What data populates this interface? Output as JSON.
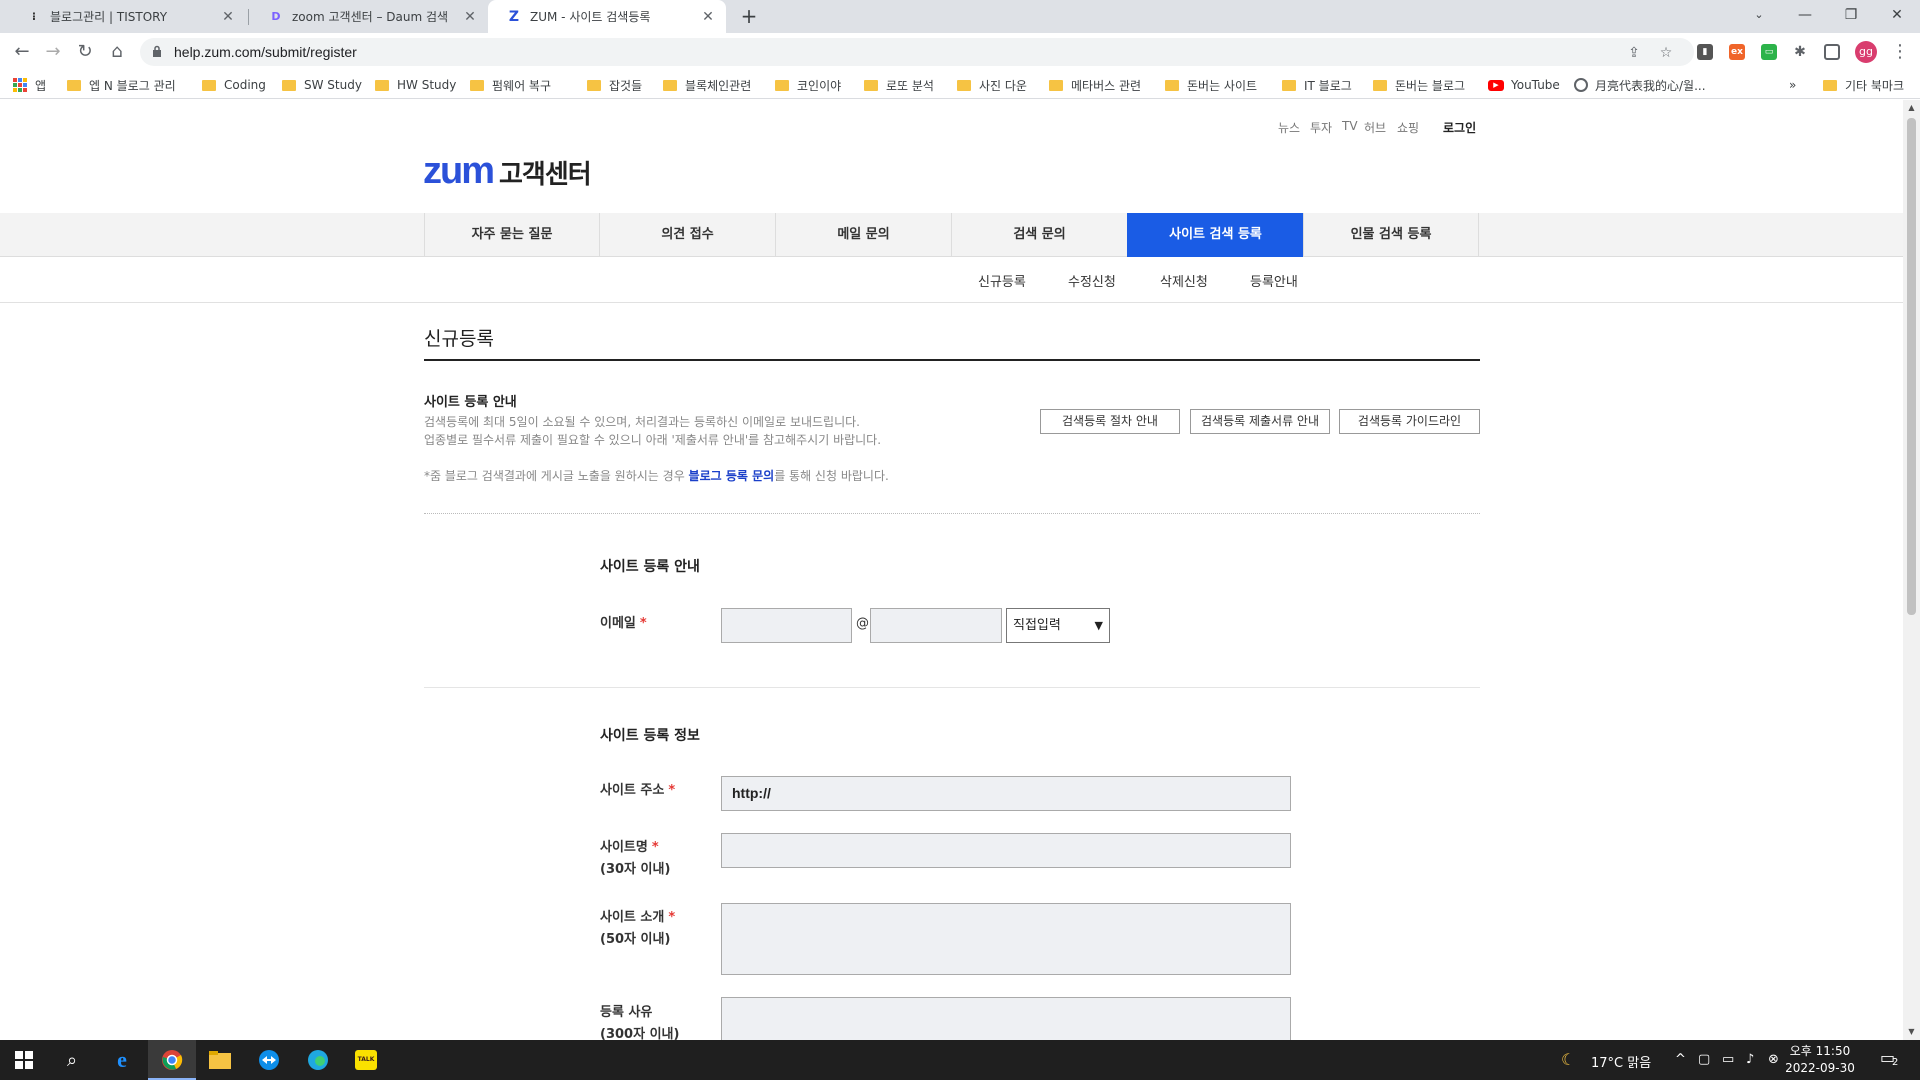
{
  "browser": {
    "tabs": [
      {
        "title": "블로그관리 | TISTORY",
        "active": false
      },
      {
        "title": "zoom 고객센터 – Daum 검색",
        "active": false
      },
      {
        "title": "ZUM - 사이트 검색등록",
        "active": true
      }
    ],
    "url": "help.zum.com/submit/register",
    "profile_initials": "gg",
    "bookmarks": [
      "앱",
      "엡 N 블로그 관리",
      "Coding",
      "SW Study",
      "HW Study",
      "펌웨어 복구",
      "잡것들",
      "블록체인관련",
      "코인이야",
      "로또 분석",
      "사진 다운",
      "메타버스 관련",
      "돈버는 사이트",
      "IT 블로그",
      "돈버는 블로그",
      "YouTube",
      "月亮代表我的心/월...",
      "»",
      "기타 북마크"
    ]
  },
  "site": {
    "util_links": [
      "뉴스",
      "투자",
      "TV",
      "허브",
      "쇼핑"
    ],
    "login": "로그인",
    "logo_text": "zum",
    "logo_suffix": "고객센터",
    "gnb": [
      "자주 묻는 질문",
      "의견 접수",
      "메일 문의",
      "검색 문의",
      "사이트 검색 등록",
      "인물 검색 등록"
    ],
    "gnb_active_index": 4,
    "lnb": [
      "신규등록",
      "수정신청",
      "삭제신청",
      "등록안내"
    ],
    "page_title": "신규등록",
    "info": {
      "title": "사이트 등록 안내",
      "line1": "검색등록에 최대 5일이 소요될 수 있으며, 처리결과는 등록하신 이메일로 보내드립니다.",
      "line2": "업종별로 필수서류 제출이 필요할 수 있으니 아래 '제출서류 안내'를 참고해주시기 바랍니다.",
      "note_prefix": "*줌 블로그 검색결과에 게시글 노출을 원하시는 경우 ",
      "note_link": "블로그 등록 문의",
      "note_suffix": "를 통해 신청 바랍니다.",
      "buttons": [
        "검색등록 절차 안내",
        "검색등록 제출서류 안내",
        "검색등록 가이드라인"
      ]
    },
    "section1": {
      "title": "사이트 등록 안내",
      "email_label": "이메일",
      "at": "@",
      "domain_select": "직접입력"
    },
    "section2": {
      "title": "사이트 등록 정보",
      "url_label": "사이트 주소",
      "url_value": "http://",
      "name_label": "사이트명",
      "name_hint": "(30자 이내)",
      "intro_label": "사이트 소개",
      "intro_hint": "(50자 이내)",
      "reason_label": "등록 사유",
      "reason_hint": "(300자 이내)"
    },
    "required_mark": "*"
  },
  "taskbar": {
    "weather": "17°C 맑음",
    "time": "오후 11:50",
    "date": "2022-09-30",
    "notification_count": "2"
  }
}
